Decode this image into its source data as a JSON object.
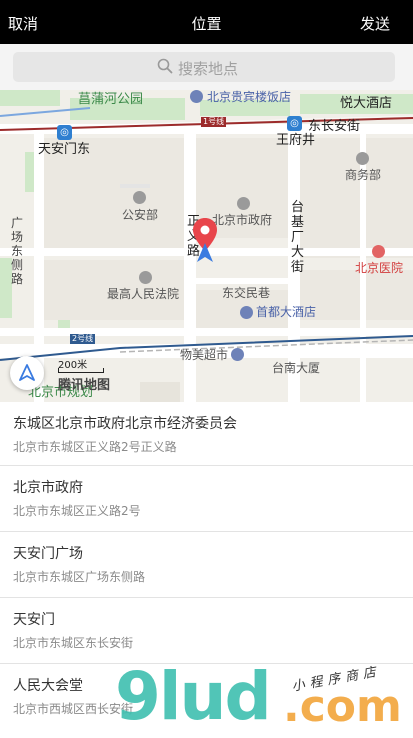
{
  "topbar": {
    "cancel": "取消",
    "title": "位置",
    "send": "发送"
  },
  "search": {
    "placeholder": "搜索地点",
    "icon": "search-icon"
  },
  "map": {
    "labels": {
      "pucaohe": "菖蒲河公园",
      "guibin": "北京贵宾楼饭店",
      "yue": "悦大酒店",
      "dongchangan": "东长安街",
      "wangfujing": "王府井",
      "line1": "1号线",
      "tiananmendong": "天安门东",
      "shangwubu": "商务部",
      "gonganbu": "公安部",
      "zhengyilu": "正义路",
      "beijingshizhengfu": "北京市政府",
      "taijichang": "台基厂大街",
      "guangchangdong": "广场东侧路",
      "beijingyiyuan": "北京医院",
      "zuigao": "最高人民法院",
      "dongjiaomin": "东交民巷",
      "shoudu": "首都大酒店",
      "line2": "2号线",
      "wumei": "物美超市",
      "taina": "台南大厦",
      "guihua": "北京市规划"
    },
    "scale": "200米",
    "logo": "腾讯地图"
  },
  "results": [
    {
      "name": "东城区北京市政府北京市经济委员会",
      "address": "北京市东城区正义路2号正义路"
    },
    {
      "name": "北京市政府",
      "address": "北京市东城区正义路2号"
    },
    {
      "name": "天安门广场",
      "address": "北京市东城区广场东侧路"
    },
    {
      "name": "天安门",
      "address": "北京市东城区东长安街"
    },
    {
      "name": "人民大会堂",
      "address": "北京市西城区西长安街"
    }
  ],
  "watermark": {
    "brand": "9lud",
    "suffix": ".com",
    "tagline": "小程序商店"
  },
  "colors": {
    "topbar": "#000000",
    "accent_pin": "#e8454b",
    "nav_arrow": "#3a7be0",
    "road_red": "#9c2b2b",
    "metro_blue": "#2f7fd0"
  }
}
